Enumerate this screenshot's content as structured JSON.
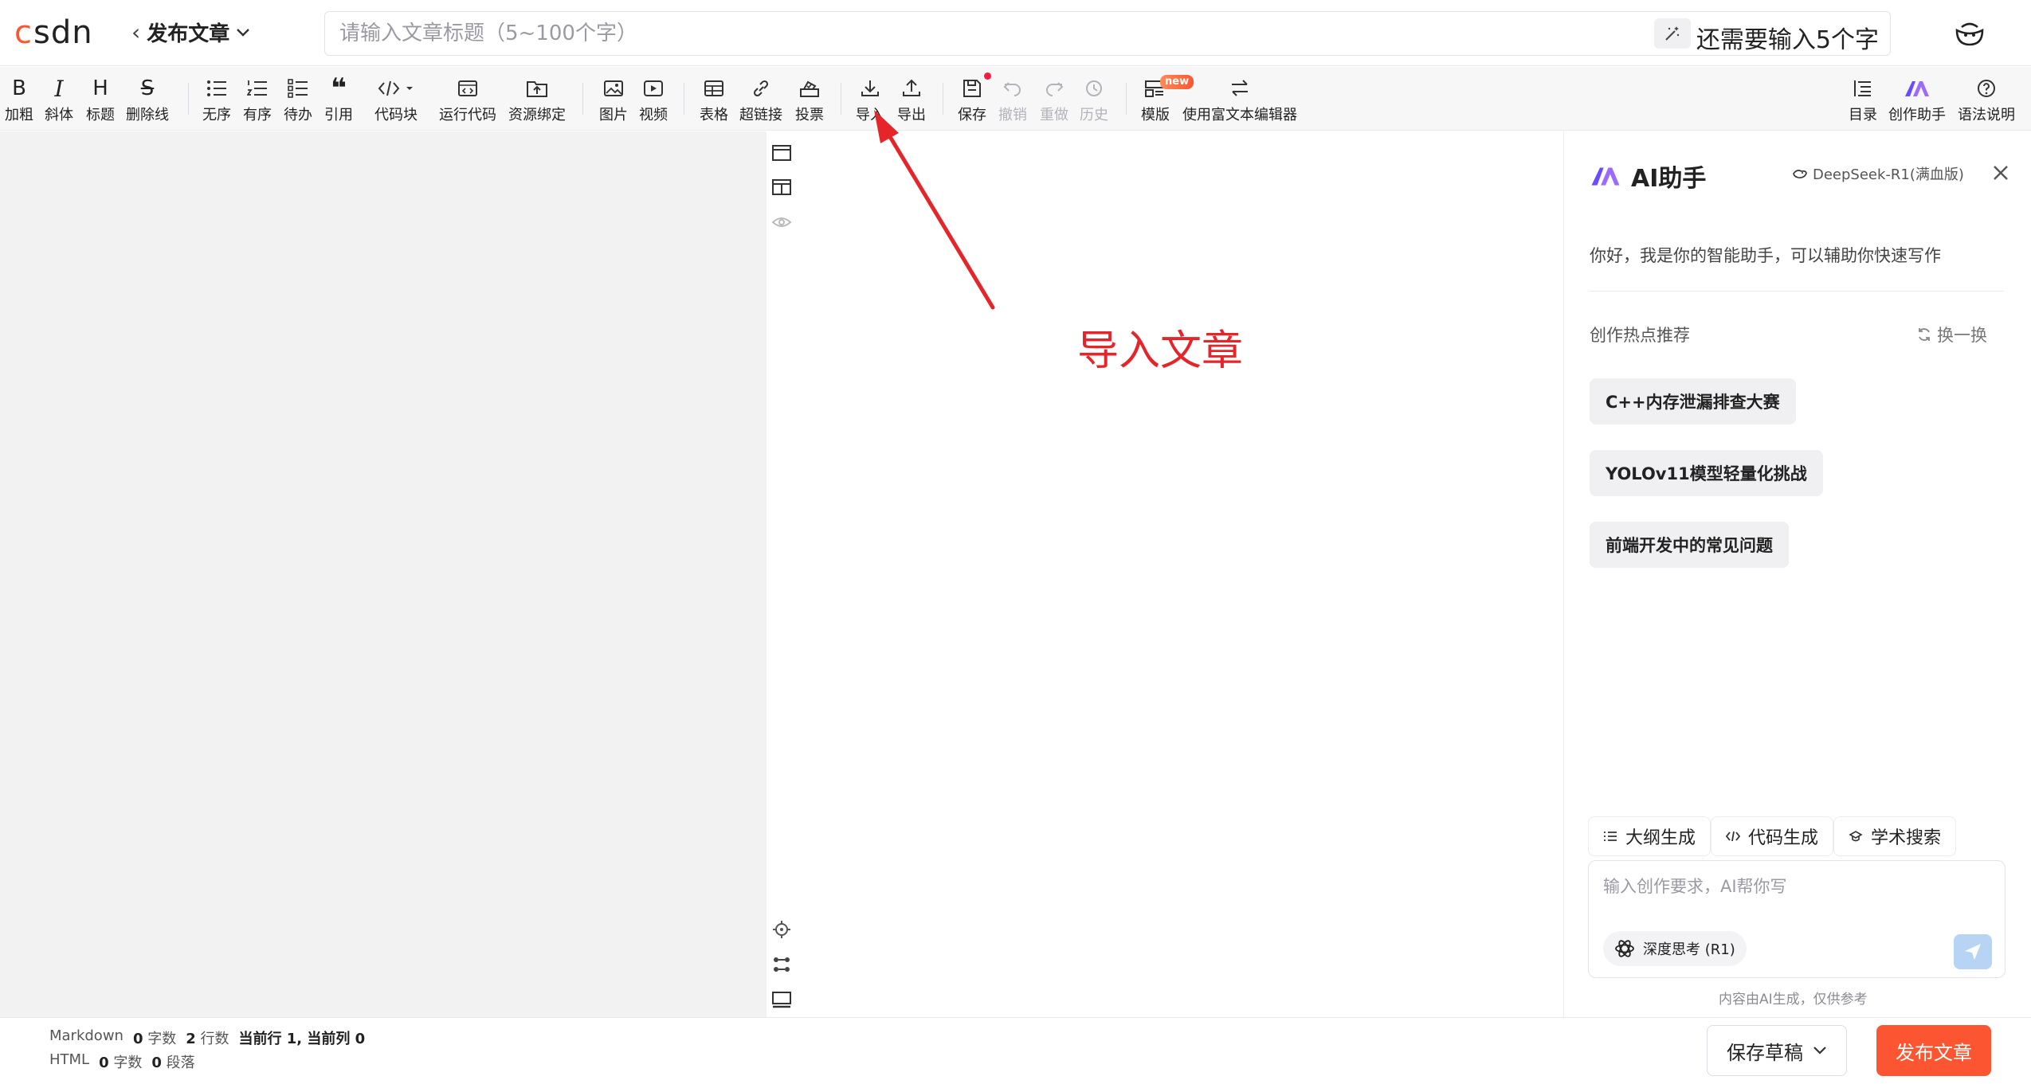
{
  "header": {
    "logo_text": "CSDN",
    "back_label": "发布文章",
    "title_placeholder": "请输入文章标题（5~100个字）",
    "remaining_text": "还需要输入5个字"
  },
  "toolbar": {
    "bold": "加粗",
    "italic": "斜体",
    "heading": "标题",
    "strike": "删除线",
    "unordered": "无序",
    "ordered": "有序",
    "todo": "待办",
    "quote": "引用",
    "codeblock": "代码块",
    "run_code": "运行代码",
    "resource": "资源绑定",
    "image": "图片",
    "video": "视频",
    "table": "表格",
    "link": "超链接",
    "vote": "投票",
    "import": "导入",
    "export": "导出",
    "save": "保存",
    "undo": "撤销",
    "redo": "重做",
    "history": "历史",
    "template": "模版",
    "template_badge": "new",
    "rich_editor": "使用富文本编辑器",
    "toc": "目录",
    "ai_assist": "创作助手",
    "syntax_help": "语法说明"
  },
  "annotation": {
    "text": "导入文章"
  },
  "ai_panel": {
    "title": "AI助手",
    "model": "DeepSeek-R1(满血版)",
    "greeting": "你好，我是你的智能助手，可以辅助你快速写作",
    "hot_title": "创作热点推荐",
    "refresh": "换一换",
    "topics": [
      "C++内存泄漏排查大赛",
      "YOLOv11模型轻量化挑战",
      "前端开发中的常见问题"
    ],
    "functions": [
      "大纲生成",
      "代码生成",
      "学术搜索"
    ],
    "prompt_placeholder": "输入创作要求，AI帮你写",
    "deep_think": "深度思考 (R1)",
    "disclaimer": "内容由AI生成，仅供参考"
  },
  "footer": {
    "md_label": "Markdown",
    "md_chars": "0",
    "md_chars_unit": "字数",
    "md_lines": "2",
    "md_lines_unit": "行数",
    "cursor": "当前行 1, 当前列 0",
    "html_label": "HTML",
    "html_chars": "0",
    "html_chars_unit": "字数",
    "html_paras": "0",
    "html_paras_unit": "段落",
    "save_draft": "保存草稿",
    "publish": "发布文章"
  },
  "colors": {
    "brand": "#fc5531",
    "annotation": "#e5252a",
    "ai_purple": "#7b5cff"
  }
}
